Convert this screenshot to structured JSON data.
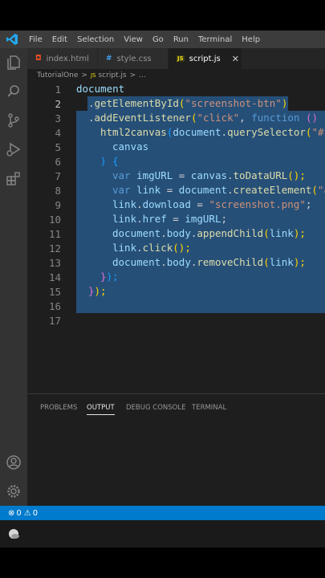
{
  "menu": [
    "File",
    "Edit",
    "Selection",
    "View",
    "Go",
    "Run",
    "Terminal",
    "Help"
  ],
  "tabs": [
    {
      "label": "index.html",
      "icon": "html5-icon"
    },
    {
      "label": "style.css",
      "icon": "css-icon"
    },
    {
      "label": "script.js",
      "icon": "js-icon",
      "active": true
    }
  ],
  "breadcrumb": {
    "folder": "TutorialOne",
    "sep": ">",
    "file": "script.js",
    "sep2": ">",
    "more": "..."
  },
  "line_numbers": [
    "1",
    "2",
    "3",
    "4",
    "5",
    "6",
    "7",
    "8",
    "9",
    "10",
    "11",
    "12",
    "13",
    "14",
    "15",
    "16",
    "17"
  ],
  "code": {
    "l1": "document",
    "l2a": ".",
    "l2b": "getElementById",
    "l2c": "(",
    "l2d": "\"screenshot-btn\"",
    "l2e": ")",
    "l3a": ".",
    "l3b": "addEventListener",
    "l3c": "(",
    "l3d": "\"click\"",
    "l3e": ", ",
    "l3f": "function",
    "l3g": " ()",
    " l3h": "{",
    "l4a": "html2canvas",
    "l4b": "(",
    "l4c": "document",
    "l4d": ".",
    "l4e": "querySelector",
    "l4f": "(",
    "l4g": "\"#s",
    "l5": "canvas",
    "l6a": ")",
    "l6b": " {",
    "l7a": "var",
    "l7b": " imgURL",
    "l7c": " = ",
    "l7d": "canvas",
    "l7e": ".",
    "l7f": "toDataURL",
    "l7g": "();",
    "l8a": "var",
    "l8b": " link",
    "l8c": " = ",
    "l8d": "document",
    "l8e": ".",
    "l8f": "createElement",
    "l8g": "(",
    "l8h": "\"a",
    "l9a": "link",
    "l9b": ".",
    "l9c": "download",
    "l9d": " = ",
    "l9e": "\"screenshot.png\"",
    "l9f": ";",
    "l10a": "link",
    "l10b": ".",
    "l10c": "href",
    "l10d": " = ",
    "l10e": "imgURL",
    "l10f": ";",
    "l11a": "document",
    "l11b": ".",
    "l11c": "body",
    "l11d": ".",
    "l11e": "appendChild",
    "l11f": "(",
    "l11g": "link",
    "l11h": ");",
    "l12a": "link",
    "l12b": ".",
    "l12c": "click",
    "l12d": "();",
    "l13a": "document",
    "l13b": ".",
    "l13c": "body",
    "l13d": ".",
    "l13e": "removeChild",
    "l13f": "(",
    "l13g": "link",
    "l13h": ");",
    "l14a": "}",
    "l14b": ");",
    "l15a": "}",
    "l15b": ");"
  },
  "panel_tabs": [
    "PROBLEMS",
    "OUTPUT",
    "DEBUG CONSOLE",
    "TERMINAL"
  ],
  "status": {
    "errors": "0",
    "warnings": "0"
  },
  "colors": {
    "accent": "#007acc",
    "selection": "#264f78",
    "editor_bg": "#1e1e1e"
  }
}
